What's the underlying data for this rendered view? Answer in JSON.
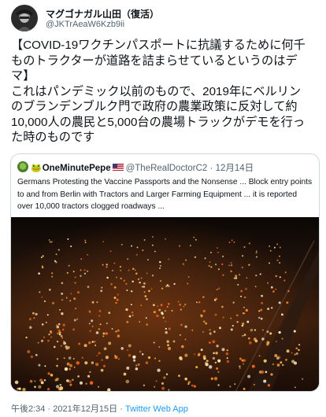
{
  "author": {
    "display_name": "マグゴナガル山田（復活）",
    "handle": "@JKTrAeaW6Kzb9ii"
  },
  "tweet": {
    "lines": [
      "【COVID-19ワクチンパスポートに抗議するために何千",
      "ものトラクターが道路を詰まらせているというのはデ",
      "マ】",
      "これはパンデミック以前のもので、2019年にベルリン",
      "のブランデンブルク門で政府の農業政策に反対して約",
      "10,000人の農民と5,000台の農場トラックがデモを行っ",
      "た時のものです"
    ]
  },
  "quoted": {
    "display_name": "OneMinutePepe",
    "handle": "@TheRealDoctorC2",
    "separator": "·",
    "date": "12月14日",
    "lines": [
      "Germans Protesting the Vaccine Passports and the Nonsense ... Block entry points",
      "to and from Berlin with Tractors and Larger Farming Equipment ... it is reported",
      "over 10,000 tractors clogged roadways ..."
    ]
  },
  "footer": {
    "time": "午後2:34",
    "separator": "·",
    "date": "2021年12月15日",
    "app": "Twitter Web App"
  }
}
